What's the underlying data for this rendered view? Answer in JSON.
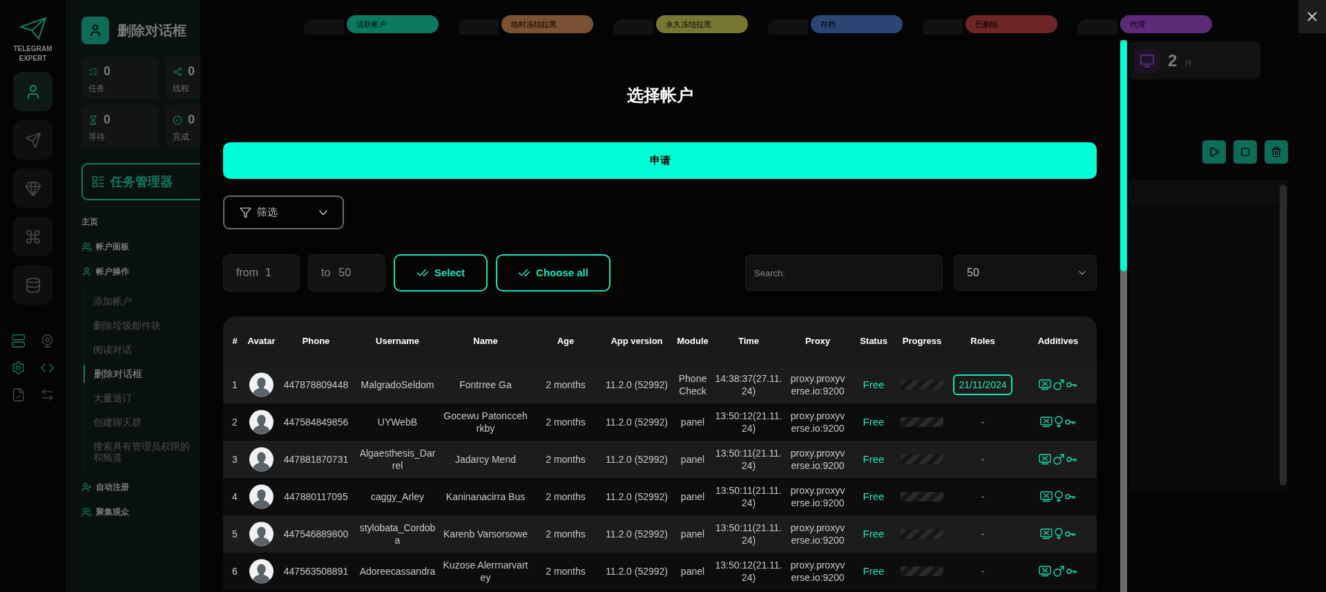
{
  "rail": {
    "logo_lines": [
      "TELEGRAM",
      "EXPERT"
    ],
    "nav": [
      {
        "selected": true
      },
      {
        "selected": false
      },
      {
        "selected": false
      },
      {
        "selected": false
      },
      {
        "selected": false
      }
    ]
  },
  "sidebar": {
    "page_title": "删除对话框",
    "stats": [
      {
        "value": "0",
        "label": "任务"
      },
      {
        "value": "0",
        "label": "线程"
      },
      {
        "value": "0",
        "label": "等待"
      },
      {
        "value": "0",
        "label": "完成"
      }
    ],
    "task_manager": "任务管理器",
    "menu": [
      {
        "kind": "section",
        "label": "主页"
      },
      {
        "kind": "group",
        "label": "帐户面板"
      },
      {
        "kind": "group",
        "label": "帐户操作",
        "children": [
          {
            "lines": [
              "添加帐户"
            ],
            "selected": false
          },
          {
            "lines": [
              "删除垃圾邮件块"
            ],
            "selected": false
          },
          {
            "lines": [
              "阅读对话"
            ],
            "selected": false
          },
          {
            "lines": [
              "删除对话框"
            ],
            "selected": true
          },
          {
            "lines": [
              "大量退订"
            ],
            "selected": false
          },
          {
            "lines": [
              "创建聊天群"
            ],
            "selected": false
          },
          {
            "lines": [
              "搜索具有管理员权限的",
              "和频道"
            ],
            "selected": false
          }
        ]
      },
      {
        "kind": "group",
        "label": "自动注册"
      },
      {
        "kind": "group",
        "label": "聚集观众"
      }
    ]
  },
  "status_tabs": [
    {
      "label": "活跃帐户",
      "color": "#0b7a61"
    },
    {
      "label": "临时冻结拉黑",
      "color": "#7a5131"
    },
    {
      "label": "永久冻结拉黑",
      "color": "#77772f"
    },
    {
      "label": "存档",
      "color": "#2b4672"
    },
    {
      "label": "已删除",
      "color": "#6f2525"
    },
    {
      "label": "代理",
      "color": "#5b2b7a"
    }
  ],
  "counter": {
    "value": "2",
    "unit": "件"
  },
  "dialog": {
    "title": "选择帐户",
    "apply_button": "申请",
    "filter": "筛选",
    "range_from": {
      "label": "from",
      "value": "1"
    },
    "range_to": {
      "label": "to",
      "value": "50"
    },
    "select_buttons": [
      "Select",
      "Choose all"
    ],
    "search": {
      "placeholder": "Search:"
    },
    "page_size": "50",
    "table": {
      "columns": [
        "#",
        "Avatar",
        "Phone",
        "Username",
        "Name",
        "Age",
        "App version",
        "Module",
        "Time",
        "Proxy",
        "Status",
        "Progress",
        "Roles",
        "Additives"
      ],
      "rows": [
        {
          "index": "1",
          "phone": "447878809448",
          "username": "MalgradoSeldom",
          "name": "Fontrree Ga",
          "age": "2 months",
          "app_version": "11.2.0 (52992)",
          "module": "PhoneCheck",
          "time": "14:38:37(27.11.24)",
          "proxy": "proxy.proxyverse.io:9200",
          "status": "Free",
          "role": {
            "kind": "badge",
            "text": "21/11/2024"
          },
          "female": false,
          "progress": {
            "level": 0
          }
        },
        {
          "index": "2",
          "phone": "447584849856",
          "username": "UYWebB",
          "name": "Gocewu Patonccehrkby",
          "age": "2 months",
          "app_version": "11.2.0 (52992)",
          "module": "panel",
          "time": "13:50:12(21.11.24)",
          "proxy": "proxy.proxyverse.io:9200",
          "status": "Free",
          "role": {
            "kind": "text",
            "text": "-"
          },
          "female": true,
          "progress": {
            "level": 0
          }
        },
        {
          "index": "3",
          "phone": "447881870731",
          "username": "Algaesthesis_Darrel",
          "name": "Jadarcy Mend",
          "age": "2 months",
          "app_version": "11.2.0 (52992)",
          "module": "panel",
          "time": "13:50:11(21.11.24)",
          "proxy": "proxy.proxyverse.io:9200",
          "status": "Free",
          "role": {
            "kind": "text",
            "text": "-"
          },
          "female": false,
          "progress": {
            "level": 0
          }
        },
        {
          "index": "4",
          "phone": "447880117095",
          "username": "caggy_Arley",
          "name": "Kaninanacirra Bus",
          "age": "2 months",
          "app_version": "11.2.0 (52992)",
          "module": "panel",
          "time": "13:50:11(21.11.24)",
          "proxy": "proxy.proxyverse.io:9200",
          "status": "Free",
          "role": {
            "kind": "text",
            "text": "-"
          },
          "female": true,
          "progress": {
            "level": 0
          }
        },
        {
          "index": "5",
          "phone": "447546889800",
          "username": "stylobata_Cordoba",
          "name": "Karenb Varsorsowe",
          "age": "2 months",
          "app_version": "11.2.0 (52992)",
          "module": "panel",
          "time": "13:50:11(21.11.24)",
          "proxy": "proxy.proxyverse.io:9200",
          "status": "Free",
          "role": {
            "kind": "text",
            "text": "-"
          },
          "female": true,
          "progress": {
            "level": 0
          }
        },
        {
          "index": "6",
          "phone": "447563508891",
          "username": "Adoreecassandra",
          "name": "Kuzose Alerrnarvartey",
          "age": "2 months",
          "app_version": "11.2.0 (52992)",
          "module": "panel",
          "time": "13:50:12(21.11.24)",
          "proxy": "proxy.proxyverse.io:9200",
          "status": "Free",
          "role": {
            "kind": "text",
            "text": "-"
          },
          "female": false,
          "progress": {
            "level": 0
          }
        }
      ]
    }
  }
}
